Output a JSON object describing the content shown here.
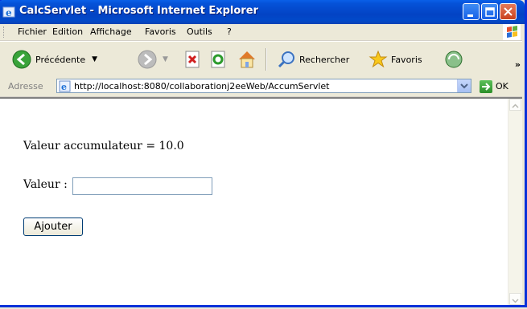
{
  "window": {
    "title": "CalcServlet - Microsoft Internet Explorer"
  },
  "menu": [
    "Fichier",
    "Edition",
    "Affichage",
    "Favoris",
    "Outils",
    "?"
  ],
  "toolbar": {
    "back_label": "Précédente",
    "search_label": "Rechercher",
    "favorites_label": "Favoris",
    "overflow": "»"
  },
  "address": {
    "label": "Adresse",
    "url": "http://localhost:8080/collaborationj2eeWeb/AccumServlet",
    "go_label": "OK"
  },
  "page": {
    "accumulator_text": "Valeur accumulateur = 10.0",
    "value_label": "Valeur :",
    "value_input": "",
    "add_button": "Ajouter"
  },
  "colors": {
    "title_bar": "#0249c9",
    "frame": "#0831d9",
    "chrome": "#ece9d8"
  }
}
